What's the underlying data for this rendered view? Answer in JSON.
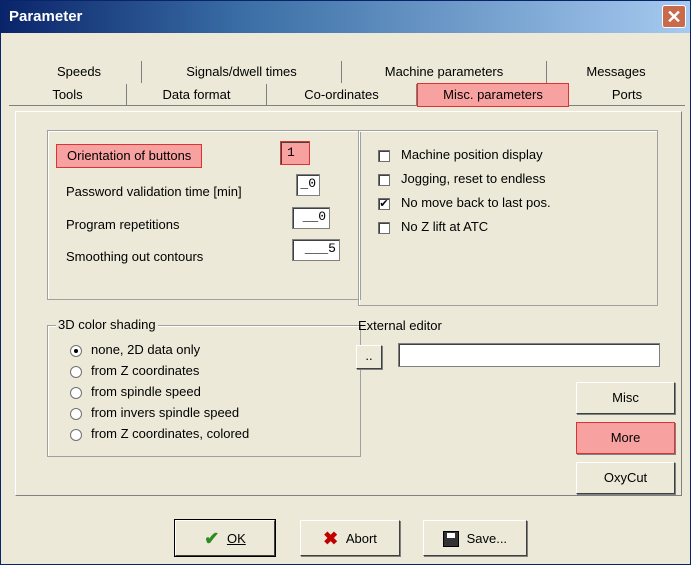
{
  "window": {
    "title": "Parameter",
    "close_glyph": "✕"
  },
  "tabs_row1": [
    {
      "label": "Speeds"
    },
    {
      "label": "Signals/dwell times"
    },
    {
      "label": "Machine parameters"
    },
    {
      "label": "Messages"
    }
  ],
  "tabs_row2": [
    {
      "label": "Tools"
    },
    {
      "label": "Data format"
    },
    {
      "label": "Co-ordinates"
    },
    {
      "label": "Misc. parameters",
      "active": true
    },
    {
      "label": "Ports"
    }
  ],
  "params": {
    "orientation": {
      "label": "Orientation of buttons",
      "value": "1"
    },
    "password": {
      "label": "Password validation time [min]",
      "value": "_0"
    },
    "repetitions": {
      "label": "Program repetitions",
      "value": "__0"
    },
    "smoothing": {
      "label": "Smoothing out contours",
      "value": "___5"
    }
  },
  "checks": [
    {
      "label": "Machine position display",
      "checked": false
    },
    {
      "label": "Jogging, reset to endless",
      "checked": false
    },
    {
      "label": "No move back to last pos.",
      "checked": true
    },
    {
      "label": "No Z lift at ATC",
      "checked": false
    }
  ],
  "shading": {
    "title": "3D color shading",
    "options": [
      {
        "label": "none, 2D data only",
        "selected": true
      },
      {
        "label": "from Z coordinates",
        "selected": false
      },
      {
        "label": "from spindle speed",
        "selected": false
      },
      {
        "label": "from invers spindle speed",
        "selected": false
      },
      {
        "label": "from Z coordinates, colored",
        "selected": false
      }
    ]
  },
  "editor": {
    "label": "External editor",
    "browse": "..",
    "value": ""
  },
  "side_buttons": {
    "misc": "Misc",
    "more": "More",
    "oxycut": "OxyCut"
  },
  "bottom_buttons": {
    "ok": "OK",
    "abort": "Abort",
    "save": "Save..."
  },
  "icons": {
    "ok": "check-icon",
    "abort": "x-icon",
    "save": "floppy-icon"
  },
  "colors": {
    "highlight": "#f7a2a0",
    "ok_green": "#2e8b1f",
    "abort_red": "#c00000"
  }
}
